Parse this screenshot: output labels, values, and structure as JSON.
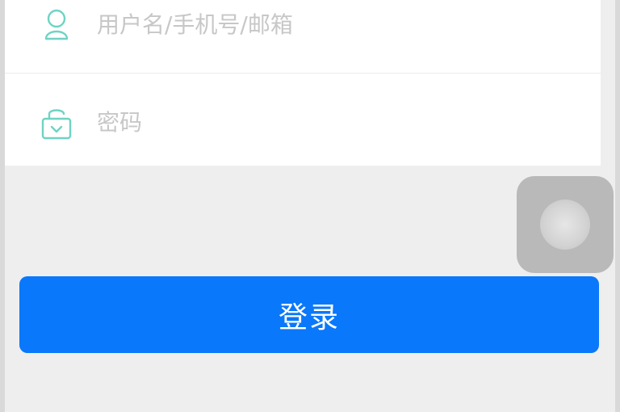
{
  "login_form": {
    "username": {
      "placeholder": "用户名/手机号/邮箱",
      "value": "",
      "icon": "user-icon"
    },
    "password": {
      "placeholder": "密码",
      "value": "",
      "icon": "lock-icon"
    },
    "submit_label": "登录"
  },
  "floating_button": {
    "icon": "assistive-touch-icon"
  },
  "colors": {
    "accent": "#0a78fa",
    "icon": "#6fd3c4",
    "background": "#eeeeee",
    "card": "#ffffff",
    "placeholder": "#c7c7c7"
  }
}
